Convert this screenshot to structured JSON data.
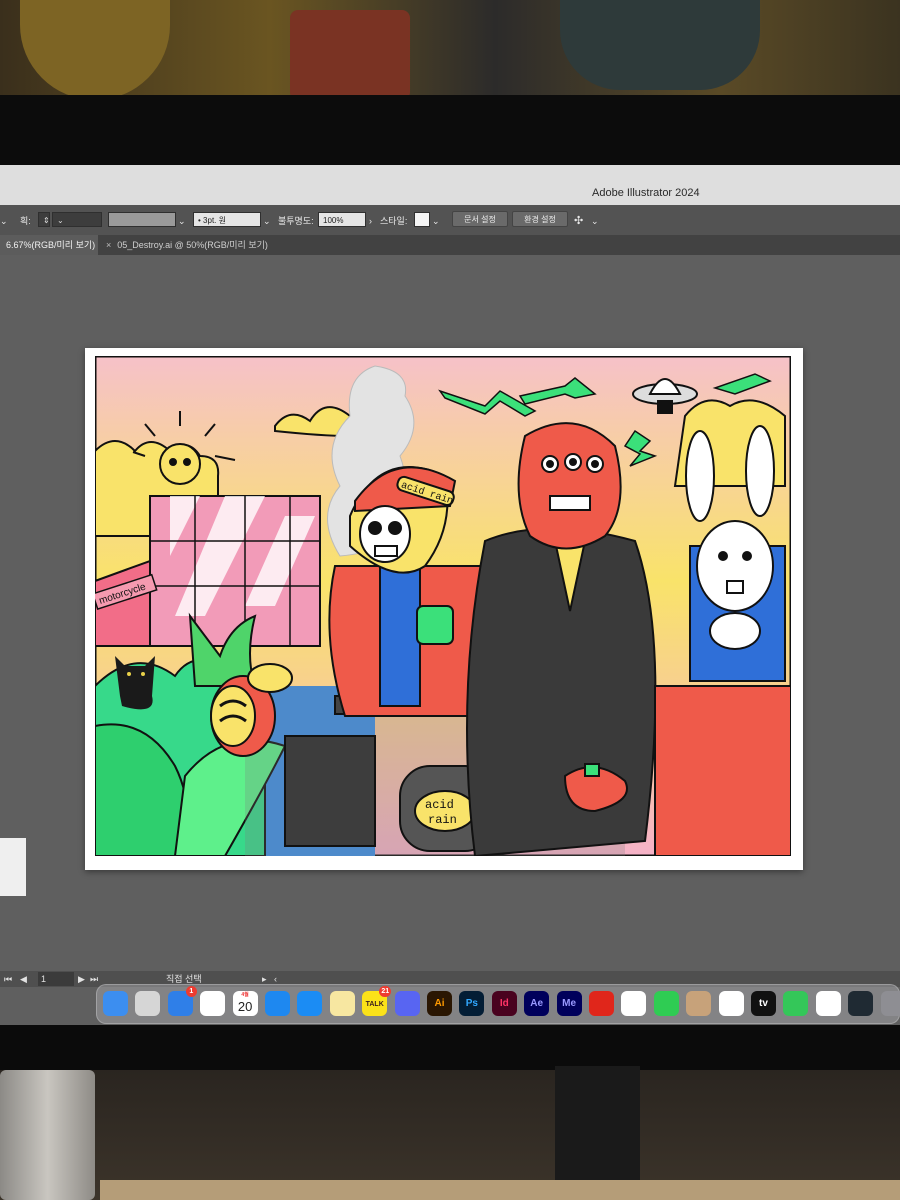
{
  "window": {
    "title": "Adobe Illustrator 2024"
  },
  "control_bar": {
    "stroke_label": "획:",
    "stroke_profile": "3pt. 원",
    "opacity_label": "불투명도:",
    "opacity_value": "100%",
    "style_label": "스타일:",
    "doc_setup_button": "문서 설정",
    "prefs_button": "환경 설정"
  },
  "tabs": [
    {
      "label": "6.67%(RGB/미리 보기)",
      "active": true
    },
    {
      "label": "05_Destroy.ai @ 50%(RGB/미리 보기)",
      "active": false
    }
  ],
  "artwork": {
    "sign_text": "motorcycle",
    "helmet_text": "acid rain",
    "tank_text_1": "acid",
    "tank_text_2": "rain"
  },
  "status_bar": {
    "artboard_number": "1",
    "tool_label": "직접 선택"
  },
  "dock": {
    "items": [
      {
        "name": "finder",
        "label": "",
        "color": "#3c8ef0"
      },
      {
        "name": "launchpad",
        "label": "",
        "color": "#d6d6d6"
      },
      {
        "name": "mail",
        "label": "",
        "color": "#2f7fe8",
        "badge": "1"
      },
      {
        "name": "chrome",
        "label": "",
        "color": "#ffffff"
      },
      {
        "name": "calendar",
        "label": "20",
        "month": "4월",
        "color": "#ffffff"
      },
      {
        "name": "safari",
        "label": "",
        "color": "#1e88f0"
      },
      {
        "name": "app-store",
        "label": "",
        "color": "#1b8cf4"
      },
      {
        "name": "notes",
        "label": "",
        "color": "#f7e7a1"
      },
      {
        "name": "kakaotalk",
        "label": "TALK",
        "color": "#fbe219",
        "badge": "21"
      },
      {
        "name": "discord",
        "label": "",
        "color": "#5865f2"
      },
      {
        "name": "illustrator",
        "label": "Ai",
        "color": "#2a1602",
        "fg": "#ff9a00"
      },
      {
        "name": "photoshop",
        "label": "Ps",
        "color": "#031d35",
        "fg": "#31a8ff"
      },
      {
        "name": "indesign",
        "label": "Id",
        "color": "#49021f",
        "fg": "#ff3366"
      },
      {
        "name": "after-effects",
        "label": "Ae",
        "color": "#00005b",
        "fg": "#9999ff"
      },
      {
        "name": "media-encoder",
        "label": "Me",
        "color": "#00005b",
        "fg": "#9999ff"
      },
      {
        "name": "acrobat",
        "label": "",
        "color": "#e0261b"
      },
      {
        "name": "photos",
        "label": "",
        "color": "#ffffff"
      },
      {
        "name": "facetime",
        "label": "",
        "color": "#2fcc53"
      },
      {
        "name": "contacts",
        "label": "",
        "color": "#c7a27a"
      },
      {
        "name": "reminders",
        "label": "",
        "color": "#ffffff"
      },
      {
        "name": "apple-tv",
        "label": "tv",
        "color": "#111111"
      },
      {
        "name": "messages",
        "label": "",
        "color": "#34c759"
      },
      {
        "name": "zoom",
        "label": "",
        "color": "#ffffff"
      },
      {
        "name": "vpn-app",
        "label": "",
        "color": "#1f2a33"
      },
      {
        "name": "system-settings",
        "label": "",
        "color": "#8e8e93"
      }
    ]
  },
  "colors": {
    "ui_gray": "#5f5f5f",
    "panel_dark": "#535353",
    "art_sky_top": "#f6c1c9",
    "art_sky_bottom": "#f9e36a",
    "art_red_face": "#ef5a4a",
    "art_green": "#3be07a"
  }
}
